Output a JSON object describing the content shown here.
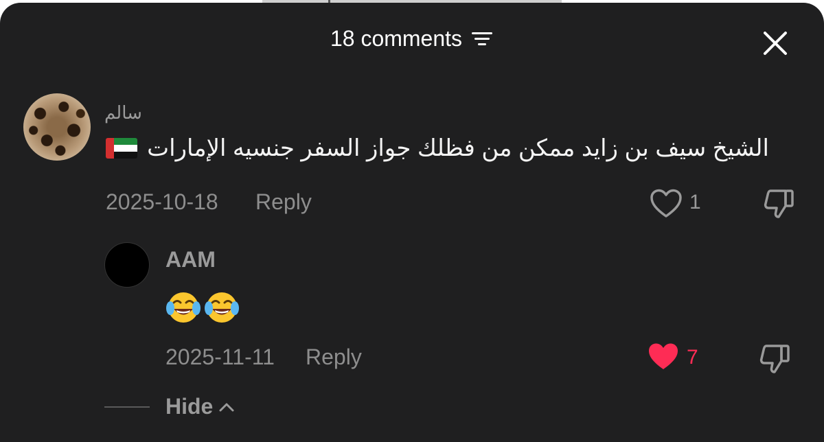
{
  "header": {
    "title": "18 comments"
  },
  "comments": [
    {
      "username": "سالم",
      "text": "الشيخ سيف بن زايد ممكن من فظلك جواز السفر جنسيه الإمارات",
      "flag": "uae-flag",
      "date": "2025-10-18",
      "reply_label": "Reply",
      "likes": "1",
      "liked": false
    }
  ],
  "replies": [
    {
      "username": "AAM",
      "emoji": [
        "face-with-tears-of-joy",
        "face-with-tears-of-joy"
      ],
      "date": "2025-11-11",
      "reply_label": "Reply",
      "likes": "7",
      "liked": true
    }
  ],
  "hide_label": "Hide",
  "colors": {
    "sheet_bg": "#1f1f20",
    "like_red": "#fe2c55",
    "muted_text": "#8e8e8e"
  }
}
